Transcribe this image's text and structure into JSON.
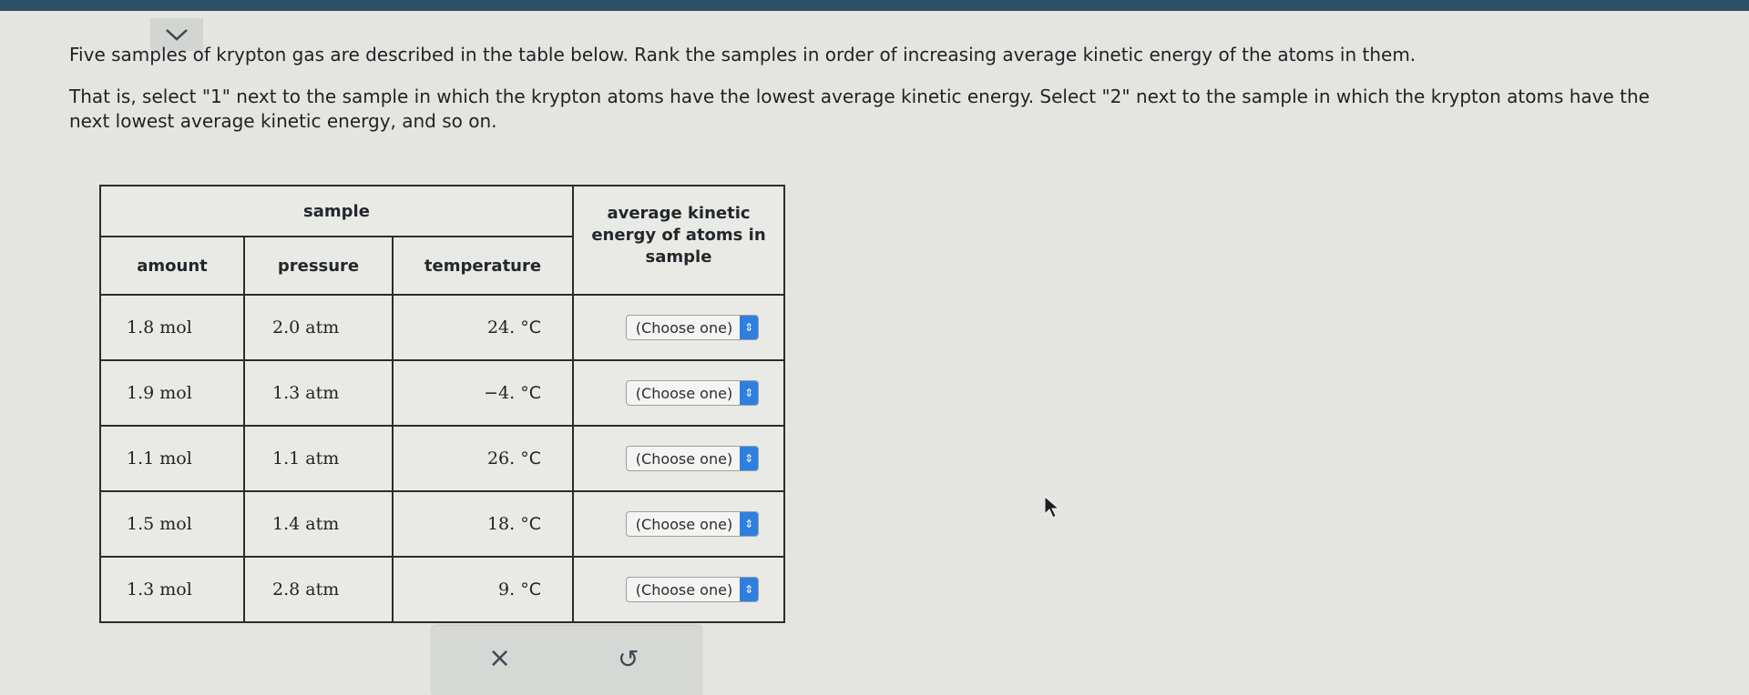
{
  "header": {
    "collapse_icon": "chevron-down-icon",
    "bar_color": "#2e5066"
  },
  "question": {
    "intro": "Five samples of krypton gas are described in the table below. Rank the samples in order of increasing average kinetic energy of the atoms in them.",
    "instruction": "That is, select \"1\" next to the sample in which the krypton atoms have the lowest average kinetic energy. Select \"2\" next to the sample in which the krypton atoms have the next lowest average kinetic energy, and so on."
  },
  "table": {
    "group_header": "sample",
    "ke_header": "average kinetic energy of atoms in sample",
    "columns": [
      "amount",
      "pressure",
      "temperature"
    ],
    "rows": [
      {
        "amount": "1.8 mol",
        "pressure": "2.0 atm",
        "temp_value": "24.",
        "temp_unit": "°C",
        "selected": "(Choose one)"
      },
      {
        "amount": "1.9 mol",
        "pressure": "1.3 atm",
        "temp_value": "−4.",
        "temp_unit": "°C",
        "selected": "(Choose one)"
      },
      {
        "amount": "1.1 mol",
        "pressure": "1.1 atm",
        "temp_value": "26.",
        "temp_unit": "°C",
        "selected": "(Choose one)"
      },
      {
        "amount": "1.5 mol",
        "pressure": "1.4 atm",
        "temp_value": "18.",
        "temp_unit": "°C",
        "selected": "(Choose one)"
      },
      {
        "amount": "1.3 mol",
        "pressure": "2.8 atm",
        "temp_value": "9.",
        "temp_unit": "°C",
        "selected": "(Choose one)"
      }
    ]
  },
  "actions": {
    "clear_label": "×",
    "undo_label": "↺"
  },
  "colors": {
    "select_arrow": "#2f7fe0",
    "background": "#e4e5e1"
  }
}
